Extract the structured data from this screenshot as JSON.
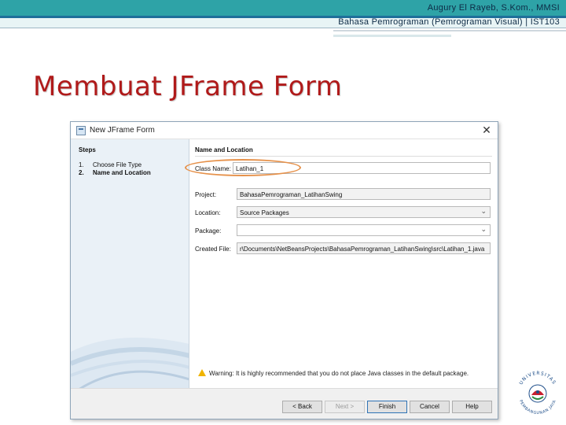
{
  "header": {
    "author": "Augury El Rayeb, S.Kom., MMSI",
    "course": "Bahasa Pemrograman (Pemrograman Visual) | IST103"
  },
  "slide": {
    "title": "Membuat JFrame Form"
  },
  "dialog": {
    "title": "New JFrame Form",
    "steps_heading": "Steps",
    "steps": [
      {
        "num": "1.",
        "label": "Choose File Type"
      },
      {
        "num": "2.",
        "label": "Name and Location"
      }
    ],
    "section_heading": "Name and Location",
    "fields": {
      "class_name": {
        "label": "Class Name:",
        "value": "Latihan_1"
      },
      "project": {
        "label": "Project:",
        "value": "BahasaPemrograman_LatihanSwing"
      },
      "location": {
        "label": "Location:",
        "value": "Source Packages"
      },
      "package": {
        "label": "Package:",
        "value": ""
      },
      "created_file": {
        "label": "Created File:",
        "value": "r\\Documents\\NetBeansProjects\\BahasaPemrograman_LatihanSwing\\src\\Latihan_1.java"
      }
    },
    "warning": "Warning: It is highly recommended that you do not place Java classes in the default package.",
    "buttons": {
      "back": "< Back",
      "next": "Next >",
      "finish": "Finish",
      "cancel": "Cancel",
      "help": "Help"
    }
  },
  "logo": {
    "text_top": "UNIVERSITAS",
    "text_bottom": "PEMBANGUNAN JAYA"
  },
  "colors": {
    "title_red": "#b01a1a",
    "header_teal": "#2ea3a7",
    "highlight_orange": "#e6914a"
  }
}
